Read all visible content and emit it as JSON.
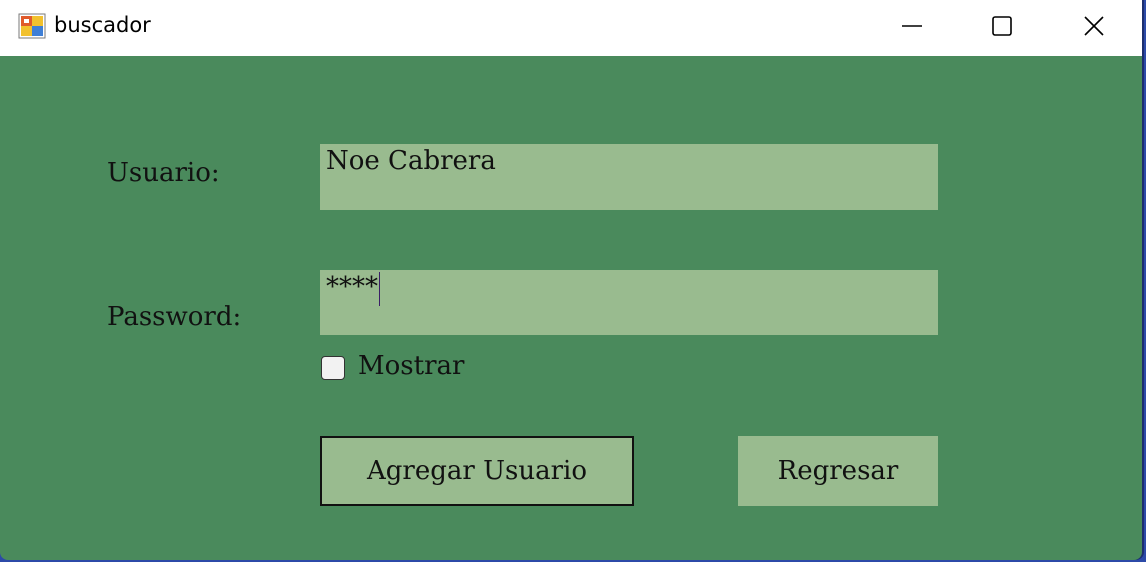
{
  "window": {
    "title": "buscador",
    "icons": {
      "app": "app-form-icon",
      "minimize": "minimize-icon",
      "maximize": "maximize-icon",
      "close": "close-icon"
    }
  },
  "form": {
    "usuario_label": "Usuario:",
    "usuario_value": "Noe Cabrera",
    "password_label": "Password:",
    "password_value": "****",
    "show_checkbox": {
      "label": "Mostrar",
      "checked": false
    },
    "add_button_label": "Agregar Usuario",
    "back_button_label": "Regresar"
  },
  "colors": {
    "background": "#4a8a5c",
    "field": "#99bb8f",
    "titlebar": "#ffffff"
  }
}
